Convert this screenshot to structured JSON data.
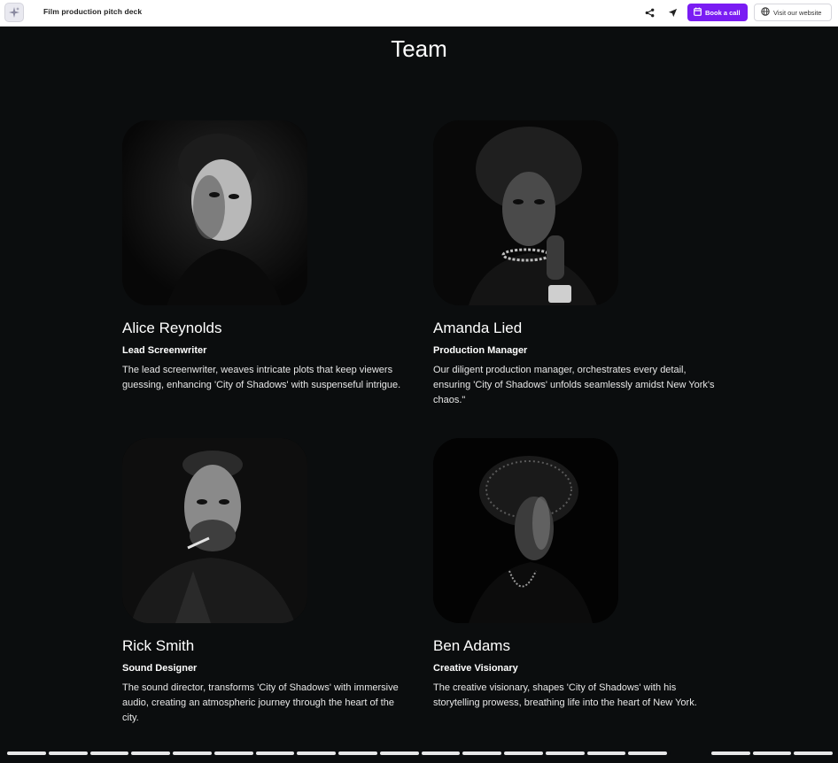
{
  "header": {
    "deck_title": "Film production pitch deck",
    "book_label": "Book a call",
    "visit_label": "Visit our website",
    "accent_color": "#7a1cf3"
  },
  "slide": {
    "title": "Team",
    "members": [
      {
        "name": "Alice Reynolds",
        "role": "Lead Screenwriter",
        "bio": "The lead screenwriter, weaves intricate plots that keep viewers guessing, enhancing 'City of Shadows' with suspenseful intrigue."
      },
      {
        "name": "Amanda Lied",
        "role": "Production Manager",
        "bio": "Our diligent production manager, orchestrates every detail, ensuring 'City of Shadows' unfolds seamlessly amidst New York's chaos.\""
      },
      {
        "name": "Rick Smith",
        "role": "Sound Designer",
        "bio": "The sound director, transforms 'City of Shadows' with immersive audio, creating an atmospheric journey through the heart of the city."
      },
      {
        "name": "Ben Adams",
        "role": "Creative Visionary",
        "bio": "The creative visionary, shapes 'City of Shadows' with his storytelling prowess, breathing life into the heart of New York."
      }
    ]
  },
  "navigation": {
    "total_slides": 20,
    "current_slide": 17
  }
}
